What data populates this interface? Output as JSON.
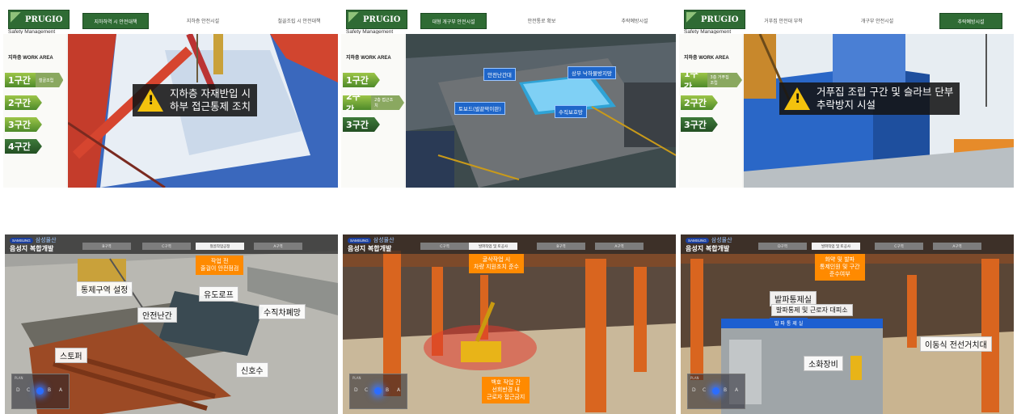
{
  "prugio": {
    "brand": "PRUGIO",
    "subtitle": "Safety Management",
    "work_area": "지하층 WORK AREA",
    "panels": [
      {
        "tabs": [
          "지하하역 시 안전대책",
          "지하층 안전시설",
          "철골조립 시 안전대책"
        ],
        "active_tab": 0,
        "zones": [
          {
            "label": "1구간",
            "note": "철골조립"
          },
          {
            "label": "2구간",
            "note": ""
          },
          {
            "label": "3구간",
            "note": ""
          },
          {
            "label": "4구간",
            "note": ""
          }
        ],
        "warning": [
          "지하층 자재반입 시",
          "하부 접근통제 조치"
        ]
      },
      {
        "tabs": [
          "대형 개구부 안전시설",
          "안전통로 확보",
          "추락예방시설"
        ],
        "active_tab": 0,
        "zones": [
          {
            "label": "1구간",
            "note": ""
          },
          {
            "label": "2구간",
            "note": "2층 접근조치"
          },
          {
            "label": "3구간",
            "note": ""
          }
        ],
        "callouts": [
          "안전난간대",
          "상부 낙하물방지망",
          "토보드(발끝막이판)",
          "수직보호망"
        ]
      },
      {
        "tabs": [
          "거푸집 안전대 부착",
          "개구부 안전시설",
          "추락예방시설"
        ],
        "active_tab": 2,
        "zones": [
          {
            "label": "1구간",
            "note": "3층 거푸집 조립"
          },
          {
            "label": "2구간",
            "note": ""
          },
          {
            "label": "3구간",
            "note": ""
          }
        ],
        "warning": [
          "거푸집 조립 구간 및 슬라브 단부",
          "추락방지 시설"
        ]
      }
    ]
  },
  "samsung": {
    "brand": "SAMSUNG",
    "brand_sub": "삼성물산",
    "project": "음성지 복합개발",
    "nav": {
      "title": "PLAN",
      "keys": [
        "D",
        "C",
        "B",
        "A"
      ]
    },
    "panels": [
      {
        "tabs": [
          "B구역",
          "C구역",
          "철골작업공정",
          "A구역"
        ],
        "active_tab": 2,
        "orange_top": [
          "작업 전",
          "줄걸이 안전점검"
        ],
        "labels": [
          "통제구역 설정",
          "유도로프",
          "안전난간",
          "수직차폐망",
          "스토퍼",
          "신호수"
        ]
      },
      {
        "tabs": [
          "발파작업 및 토공사",
          "C구역",
          "B구역",
          "A구역"
        ],
        "active_tab": 0,
        "orange_top": [
          "굴삭작업 시",
          "차량 지원조치 준수"
        ],
        "orange_bottom": [
          "백호 작업 간",
          "선회반경 내",
          "근로자 접근금지"
        ],
        "labels": []
      },
      {
        "tabs": [
          "D구역",
          "발파작업 및 토공사",
          "C구역",
          "A구역"
        ],
        "active_tab": 1,
        "orange_top": [
          "화약 및 발파",
          "통제인원 및 구간",
          "준수여부"
        ],
        "labels": [
          "발파통제실",
          "발파통제 및 근로자 대피소",
          "발 파 통 제 실",
          "소화장비",
          "이동식 전선거치대"
        ]
      }
    ]
  }
}
